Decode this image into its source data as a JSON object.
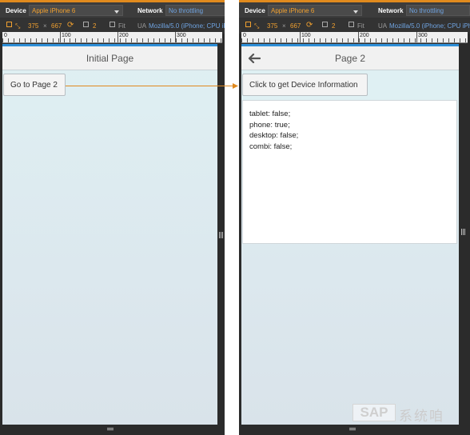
{
  "devtools": {
    "device_label": "Device",
    "device_value": "Apple iPhone 6",
    "network_label": "Network",
    "network_value": "No throttling",
    "width": "375",
    "times": "×",
    "height": "667",
    "dpr": "2",
    "fit_label": "Fit",
    "ua_label": "UA",
    "ua_value": "Mozilla/5.0 (iPhone; CPU iPh"
  },
  "ruler": {
    "ticks": [
      "0",
      "100",
      "200",
      "300"
    ]
  },
  "left": {
    "title": "Initial Page",
    "button_label": "Go to Page 2"
  },
  "right": {
    "title": "Page 2",
    "button_label": "Click to get Device Information",
    "info_lines": [
      "tablet: false;",
      "phone: true;",
      "desktop: false;",
      "combi: false;"
    ]
  },
  "watermark": {
    "brand": "SAP",
    "text": "系统咱"
  },
  "colors": {
    "devtools_bg": "#2b2b2b",
    "accent_orange": "#e08a1e",
    "accent_blue": "#2e8fd8",
    "screen_bg": "#dff0f3",
    "arrow": "#e0891e"
  }
}
